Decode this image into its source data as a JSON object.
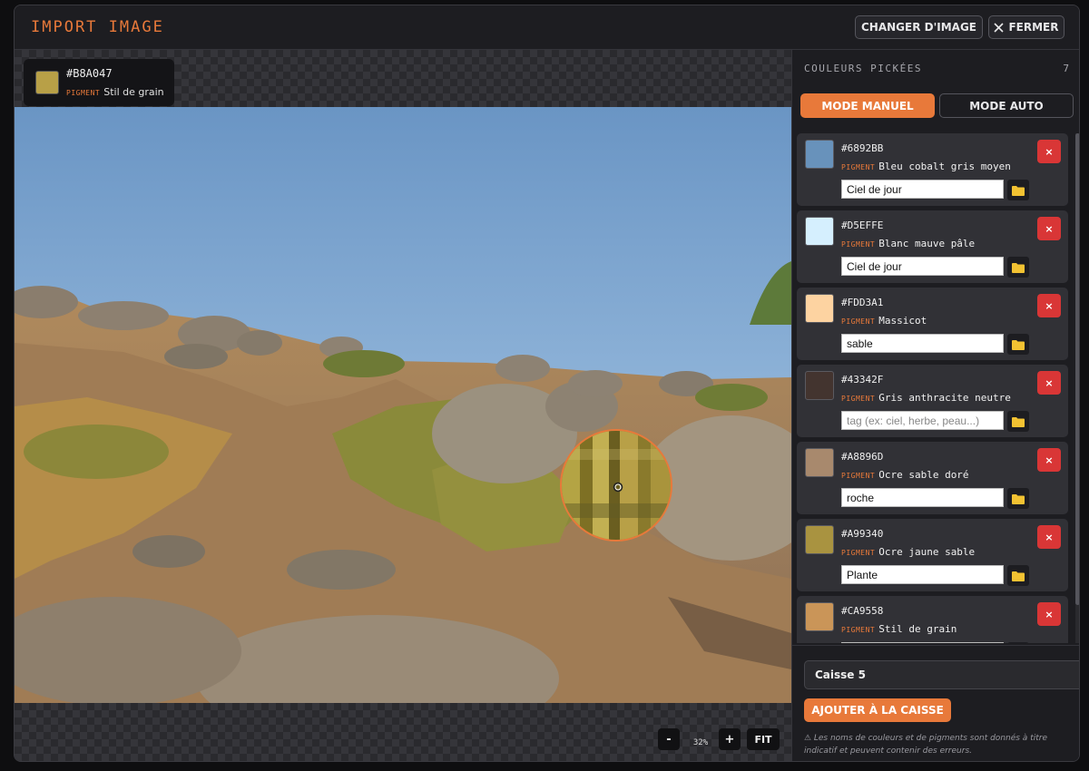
{
  "header": {
    "title": "IMPORT IMAGE",
    "change_label": "CHANGER D'IMAGE",
    "close_label": "FERMER"
  },
  "hover": {
    "hex": "#B8A047",
    "pigment_label": "PIGMENT",
    "pigment": "Stil de grain",
    "color": "#B8A047"
  },
  "zoom": {
    "minus": "-",
    "value": "32%",
    "plus": "+",
    "fit": "FIT"
  },
  "sidebar": {
    "title": "COULEURS PICKÉES",
    "count": "7",
    "mode_manual": "MODE MANUEL",
    "mode_auto": "MODE AUTO",
    "colors": [
      {
        "hex": "#6892BB",
        "pigment": "Bleu cobalt gris moyen",
        "tag": "Ciel de jour",
        "placeholder": "tag (ex: ciel, herbe, peau...)"
      },
      {
        "hex": "#D5EFFE",
        "pigment": "Blanc mauve pâle",
        "tag": "Ciel de jour",
        "placeholder": "tag (ex: ciel, herbe, peau...)"
      },
      {
        "hex": "#FDD3A1",
        "pigment": "Massicot",
        "tag": "sable",
        "placeholder": "tag (ex: ciel, herbe, peau...)"
      },
      {
        "hex": "#43342F",
        "pigment": "Gris anthracite neutre",
        "tag": "",
        "placeholder": "tag (ex: ciel, herbe, peau...)"
      },
      {
        "hex": "#A8896D",
        "pigment": "Ocre sable doré",
        "tag": "roche",
        "placeholder": "tag (ex: ciel, herbe, peau...)"
      },
      {
        "hex": "#A99340",
        "pigment": "Ocre jaune sable",
        "tag": "Plante",
        "placeholder": "tag (ex: ciel, herbe, peau...)"
      },
      {
        "hex": "#CA9558",
        "pigment": "Stil de grain",
        "tag": "",
        "placeholder": "tag (ex: ciel, herbe, peau...)"
      }
    ],
    "pigment_label": "PIGMENT",
    "delete_icon": "×",
    "crate": "Caisse 5",
    "add_label": "AJOUTER À LA CAISSE",
    "disclaimer": "⚠ Les noms de couleurs et de pigments sont donnés à titre indicatif et peuvent contenir des erreurs."
  }
}
